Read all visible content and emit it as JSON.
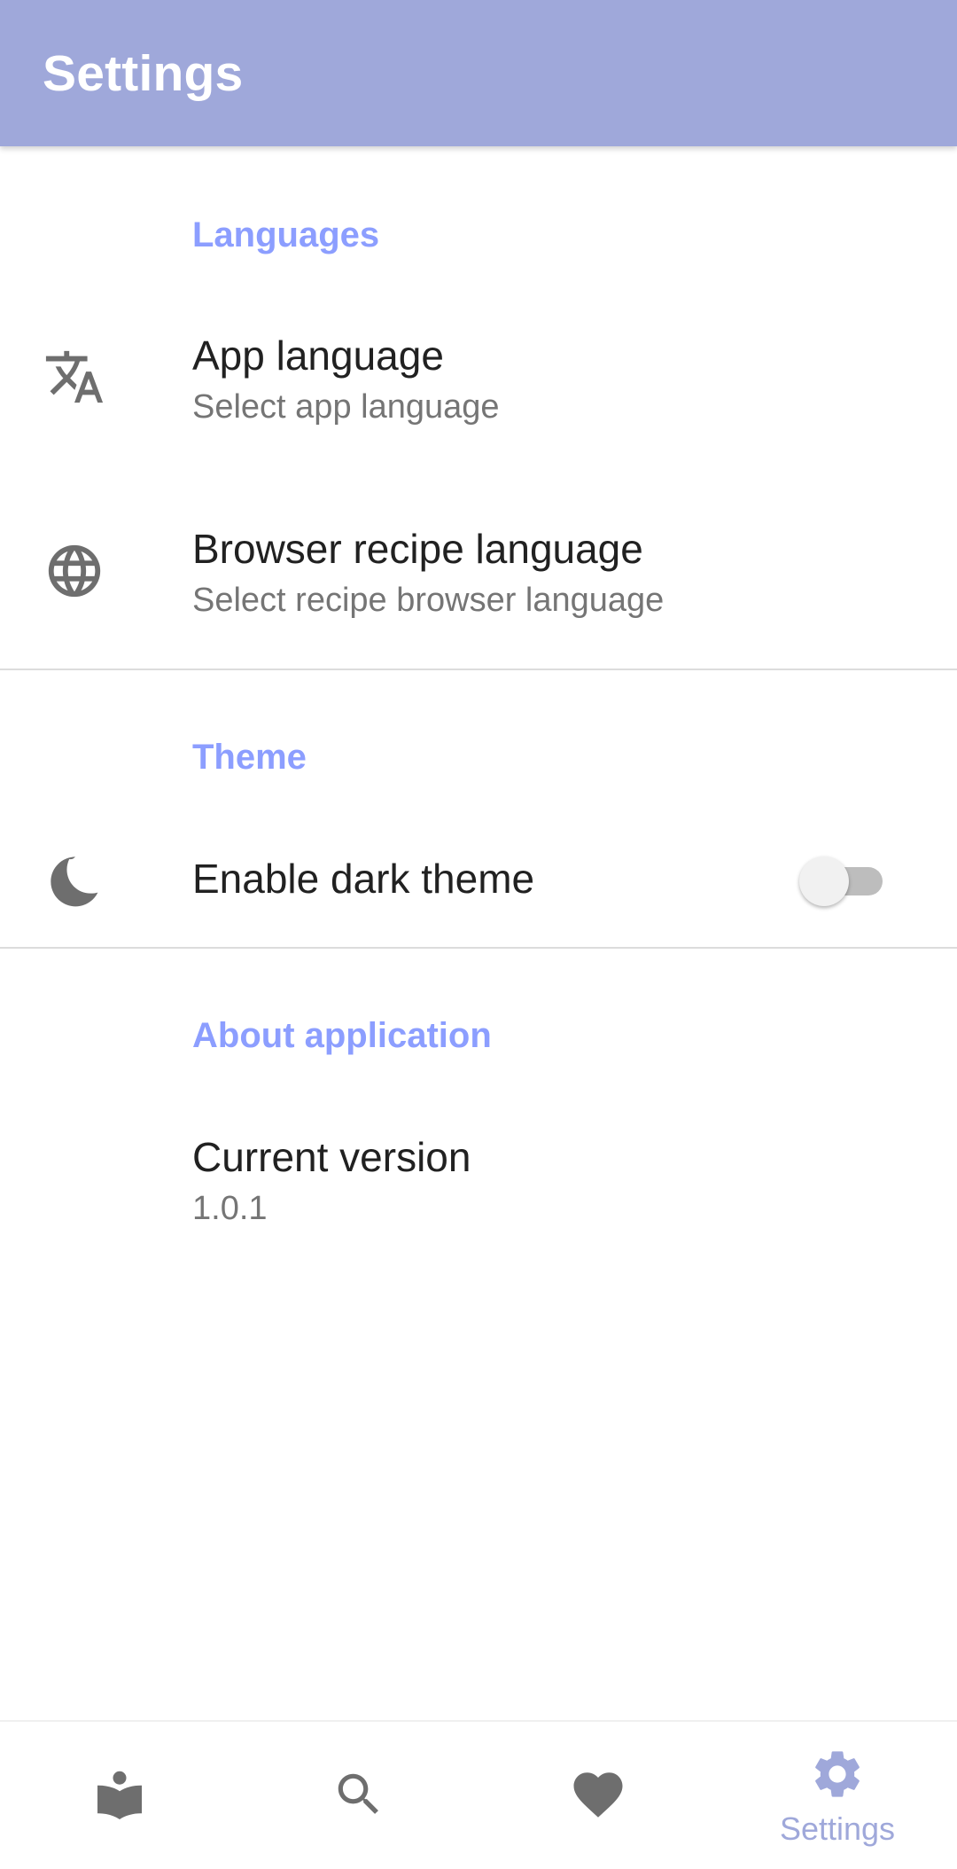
{
  "app_bar": {
    "title": "Settings"
  },
  "sections": {
    "languages": {
      "header": "Languages",
      "app_language": {
        "title": "App language",
        "summary": "Select app language",
        "icon": "translate-icon"
      },
      "browser_language": {
        "title": "Browser recipe language",
        "summary": "Select recipe browser language",
        "icon": "globe-icon"
      }
    },
    "theme": {
      "header": "Theme",
      "dark_theme": {
        "title": "Enable dark theme",
        "enabled": false,
        "icon": "moon-icon"
      }
    },
    "about": {
      "header": "About application",
      "version": {
        "title": "Current version",
        "value": "1.0.1"
      }
    }
  },
  "bottom_nav": {
    "items": [
      {
        "icon": "recipe-book-icon",
        "label": "",
        "active": false
      },
      {
        "icon": "search-icon",
        "label": "",
        "active": false
      },
      {
        "icon": "heart-icon",
        "label": "",
        "active": false
      },
      {
        "icon": "gear-icon",
        "label": "Settings",
        "active": true
      }
    ]
  },
  "colors": {
    "primary": "#9fa8da",
    "accent": "#8c9eff",
    "icon_gray": "#6e6e6e"
  }
}
